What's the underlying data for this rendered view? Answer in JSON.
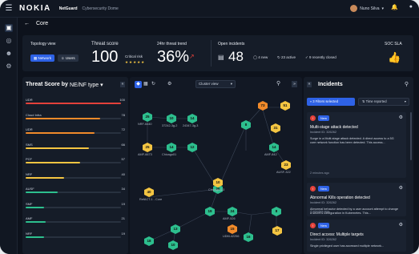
{
  "header": {
    "logo": "NOKIA",
    "app_name": "NetGuard",
    "subtitle": "Cybersecurity Dome",
    "user": "Nuno Silva"
  },
  "breadcrumb": {
    "title": "Core"
  },
  "kpi": {
    "topology": {
      "label": "Topology view",
      "network_btn": "Network",
      "users_btn": "Users"
    },
    "threat_score": {
      "label": "Threat score",
      "value": "100",
      "status": "Critical risk"
    },
    "trend": {
      "label": "24hr threat trend",
      "value": "36%"
    },
    "incidents": {
      "label": "Open incidents",
      "count": "48",
      "new": "4 new",
      "active": "23 active",
      "closed": "9 recently closed"
    },
    "sla": {
      "label": "SOC SLA"
    }
  },
  "scores": {
    "title": "Threat Score by",
    "type": "NE/NF type",
    "rows": [
      {
        "label": "UDR",
        "value": 100,
        "color": "#e4413a"
      },
      {
        "label": "Cloud Infra",
        "value": 78,
        "color": "#f08a2a"
      },
      {
        "label": "UDR",
        "value": 72,
        "color": "#f08a2a"
      },
      {
        "label": "SMS",
        "value": 66,
        "color": "#f4c542"
      },
      {
        "label": "PCF",
        "value": 57,
        "color": "#f4c542"
      },
      {
        "label": "NRF",
        "value": 40,
        "color": "#f4c542"
      },
      {
        "label": "AUSF",
        "value": 34,
        "color": "#2dbf8e"
      },
      {
        "label": "SMF",
        "value": 19,
        "color": "#2dbf8e"
      },
      {
        "label": "AMF",
        "value": 21,
        "color": "#2dbf8e"
      },
      {
        "label": "NRF",
        "value": 19,
        "color": "#2dbf8e"
      }
    ]
  },
  "topology": {
    "view_select": "Cluster view",
    "nodes": [
      {
        "id": "25",
        "label": "NRF-6440",
        "color": "#2dbf8e"
      },
      {
        "id": "10",
        "label": "37242-3g-2",
        "color": "#2dbf8e"
      },
      {
        "id": "14",
        "label": "24347-3g-3",
        "color": "#2dbf8e"
      },
      {
        "id": "73",
        "label": "",
        "color": "#f08a2a"
      },
      {
        "id": "51",
        "label": "",
        "color": "#f4c542"
      },
      {
        "id": "31",
        "label": "",
        "color": "#f4c542"
      },
      {
        "id": "25",
        "label": "AMF-6673",
        "color": "#f4c542"
      },
      {
        "id": "14",
        "label": "Chicago01",
        "color": "#2dbf8e"
      },
      {
        "id": "12",
        "label": "",
        "color": "#2dbf8e"
      },
      {
        "id": "8",
        "label": "",
        "color": "#2dbf8e"
      },
      {
        "id": "14",
        "label": "AMF-842",
        "color": "#2dbf8e"
      },
      {
        "id": "23",
        "label": "AUSF-322",
        "color": "#f4c542"
      },
      {
        "id": "40",
        "label": "RefACT-1 - Core",
        "color": "#f4c542"
      },
      {
        "id": "25",
        "label": "",
        "color": "#2dbf8e"
      },
      {
        "id": "19",
        "label": "",
        "color": "#2dbf8e"
      },
      {
        "id": "24",
        "label": "AMF-526",
        "color": "#2dbf8e"
      },
      {
        "id": "15",
        "label": "UDM-42256",
        "color": "#f08a2a"
      },
      {
        "id": "17",
        "label": "",
        "color": "#f4c542"
      },
      {
        "id": "13",
        "label": "",
        "color": "#2dbf8e"
      },
      {
        "id": "18",
        "label": "",
        "color": "#2dbf8e"
      },
      {
        "id": "10",
        "label": "",
        "color": "#2dbf8e"
      },
      {
        "id": "16",
        "label": "",
        "color": "#2dbf8e"
      },
      {
        "id": "8",
        "label": "",
        "color": "#2dbf8e"
      },
      {
        "id": "10",
        "label": "Chicago123",
        "color": "#f4c542"
      }
    ]
  },
  "incidents": {
    "title": "Incidents",
    "filter_btn": "3 Filters selected",
    "sort_select": "Time reported",
    "items": [
      {
        "title": "Multi-stage attack detected",
        "id": "Incident ID: 326262",
        "desc": "Surge in a Multi-stage attack detected. A direct access to a 5G core network function has been detected. This access...",
        "age": "2 minutes ago",
        "badge": "New"
      },
      {
        "title": "Abnormal Kills operation detected",
        "id": "Incident ID: 326262",
        "desc": "Abnormal behavior detected by a user account attempt to change a secret's configuration in Kubernetes. This...",
        "age": "4 minutes ago",
        "badge": "New"
      },
      {
        "title": "Direct access: Multiple targets",
        "id": "Incident ID: 326262",
        "desc": "Single privileged user has accessed multiple network...",
        "age": "",
        "badge": "New"
      }
    ]
  }
}
